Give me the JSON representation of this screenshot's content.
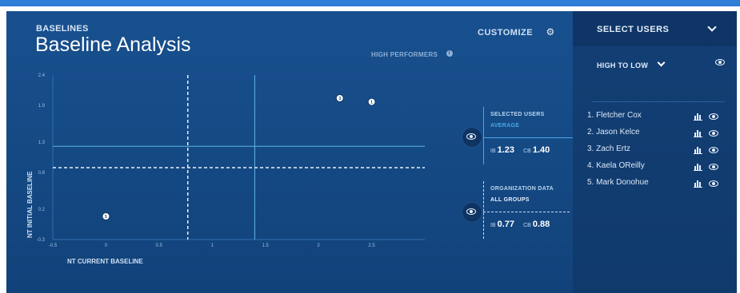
{
  "header": {
    "section_label": "BASELINES",
    "title": "Baseline Analysis",
    "high_performers": "HIGH PERFORMERS",
    "customize": "CUSTOMIZE"
  },
  "select_users": {
    "label": "SELECT USERS",
    "sort": "HIGH TO LOW",
    "users": [
      "1. Fletcher Cox",
      "2. Jason Kelce",
      "3. Zach Ertz",
      "4. Kaela OReilly",
      "5. Mark Donohue"
    ]
  },
  "stats": {
    "selected": {
      "title": "SELECTED USERS",
      "subtitle": "AVERAGE",
      "ib_label": "IB",
      "ib_value": "1.23",
      "cb_label": "CB",
      "cb_value": "1.40"
    },
    "organization": {
      "title": "ORGANIZATION DATA",
      "subtitle": "ALL GROUPS",
      "ib_label": "IB",
      "ib_value": "0.77",
      "cb_label": "CB",
      "cb_value": "0.88"
    }
  },
  "chart_data": {
    "type": "scatter",
    "xlabel": "NT CURRENT BASELINE",
    "ylabel": "NT INITIAL BASELINE",
    "xlim": [
      -0.5,
      3.0
    ],
    "ylim": [
      -0.3,
      2.4
    ],
    "x_ticks": [
      "-0.5",
      "0",
      "0.5",
      "1",
      "1.5",
      "2",
      "2.5"
    ],
    "y_ticks": [
      "2.4",
      "1.9",
      "1.3",
      "0.8",
      "0.2",
      "-0.3"
    ],
    "points": [
      {
        "label": "3",
        "x": 2.2,
        "y": 2.02
      },
      {
        "label": "1",
        "x": 2.5,
        "y": 1.96
      },
      {
        "label": "5",
        "x": 0.0,
        "y": 0.08
      }
    ],
    "reference_lines": {
      "selected_average": {
        "x": 1.4,
        "y": 1.23,
        "style": "solid"
      },
      "organization_average": {
        "x": 0.77,
        "y": 0.88,
        "style": "dashed"
      }
    }
  },
  "colors": {
    "background": "#154b86",
    "panel": "#103a6c",
    "accent": "#5fb4ea",
    "text": "#ffffff"
  }
}
